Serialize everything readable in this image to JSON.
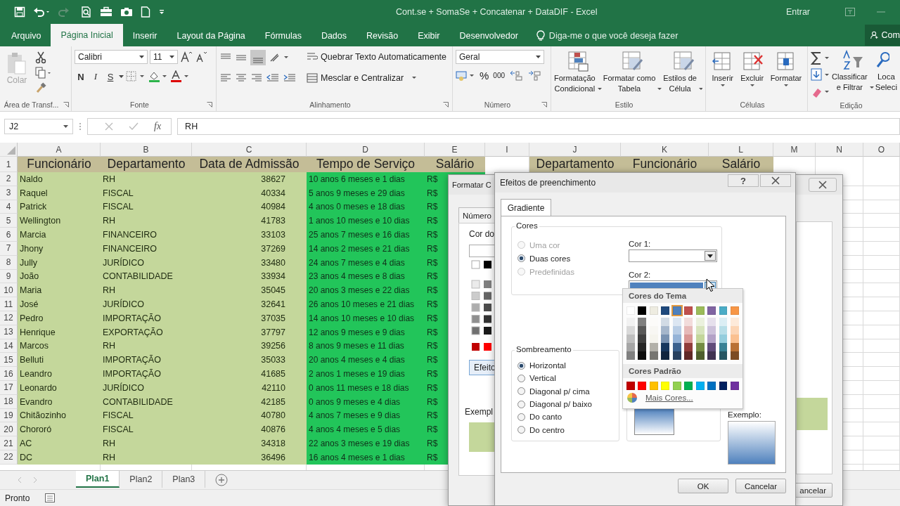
{
  "title_bar": {
    "title": "Cont.se + SomaSe + Concatenar + DataDIF - Excel",
    "sign_in": "Entrar"
  },
  "ribbon_tabs": [
    {
      "label": "Arquivo",
      "selected": false
    },
    {
      "label": "Página Inicial",
      "selected": true
    },
    {
      "label": "Inserir",
      "selected": false
    },
    {
      "label": "Layout da Página",
      "selected": false
    },
    {
      "label": "Fórmulas",
      "selected": false
    },
    {
      "label": "Dados",
      "selected": false
    },
    {
      "label": "Revisão",
      "selected": false
    },
    {
      "label": "Exibir",
      "selected": false
    },
    {
      "label": "Desenvolvedor",
      "selected": false
    }
  ],
  "tell_me": "Diga-me o que você deseja fazer",
  "share": "Com",
  "ribbon": {
    "clipboard": {
      "paste": "Colar",
      "paste_disabled": true,
      "label": "Área de Transf..."
    },
    "font": {
      "name": "Calibri",
      "size": "11",
      "bold": "N",
      "italic": "I",
      "underline": "S",
      "label": "Fonte"
    },
    "alignment": {
      "wrap": "Quebrar Texto Automaticamente",
      "merge": "Mesclar e Centralizar",
      "label": "Alinhamento"
    },
    "number": {
      "format": "Geral",
      "percent": "%",
      "thousands": "000",
      "label": "Número"
    },
    "styles": {
      "buttons": [
        [
          "Formatação",
          "Condicional"
        ],
        [
          "Formatar como",
          "Tabela"
        ],
        [
          "Estilos de",
          "Célula"
        ]
      ],
      "label": "Estilo"
    },
    "cells": {
      "buttons": [
        "Inserir",
        "Excluir",
        "Formatar"
      ],
      "label": "Células"
    },
    "editing": {
      "sort": [
        "Classificar",
        "e Filtrar"
      ],
      "find": [
        "Loca",
        "Seleci"
      ],
      "label": "Edição"
    }
  },
  "formula_bar": {
    "name_box": "J2",
    "fx": "fx",
    "formula": "RH"
  },
  "sheet": {
    "columns": [
      {
        "letter": "A",
        "kind": "text"
      },
      {
        "letter": "B",
        "kind": "text"
      },
      {
        "letter": "C",
        "kind": "number"
      },
      {
        "letter": "D",
        "kind": "duration"
      },
      {
        "letter": "E",
        "kind": "currency"
      },
      {
        "letter": "I",
        "kind": "blank"
      },
      {
        "letter": "J",
        "kind": "lookup"
      },
      {
        "letter": "K",
        "kind": "lookup"
      },
      {
        "letter": "L",
        "kind": "lookup"
      },
      {
        "letter": "M",
        "kind": "blank"
      },
      {
        "letter": "N",
        "kind": "blank"
      },
      {
        "letter": "O",
        "kind": "blank"
      }
    ],
    "header_row": {
      "number": "1",
      "cells": [
        "Funcionário",
        "Departamento",
        "Data de Admissão",
        "Tempo de Serviço",
        "Salário"
      ],
      "lookup_cells": [
        "Departamento",
        "Funcionário",
        "Salário"
      ]
    },
    "rows": [
      {
        "number": "2",
        "cells": [
          "Naldo",
          "RH",
          "38627",
          "10 anos 6 meses e 1 dias",
          "R$"
        ]
      },
      {
        "number": "3",
        "cells": [
          "Raquel",
          "FISCAL",
          "40334",
          "5 anos 9 meses e 29 dias",
          "R$"
        ]
      },
      {
        "number": "4",
        "cells": [
          "Patrick",
          "FISCAL",
          "40984",
          "4 anos 0 meses e 18 dias",
          "R$"
        ]
      },
      {
        "number": "5",
        "cells": [
          "Wellington",
          "RH",
          "41783",
          "1 anos 10 meses e 10 dias",
          "R$"
        ]
      },
      {
        "number": "6",
        "cells": [
          "Marcia",
          "FINANCEIRO",
          "33103",
          "25 anos 7 meses e 16 dias",
          "R$"
        ]
      },
      {
        "number": "7",
        "cells": [
          "Jhony",
          "FINANCEIRO",
          "37269",
          "14 anos 2 meses e 21 dias",
          "R$"
        ]
      },
      {
        "number": "8",
        "cells": [
          "Jully",
          "JURÍDICO",
          "33480",
          "24 anos 7 meses e 4 dias",
          "R$"
        ]
      },
      {
        "number": "9",
        "cells": [
          "João",
          "CONTABILIDADE",
          "33934",
          "23 anos 4 meses e 8 dias",
          "R$"
        ]
      },
      {
        "number": "10",
        "cells": [
          "Maria",
          "RH",
          "35045",
          "20 anos 3 meses e 22 dias",
          "R$"
        ]
      },
      {
        "number": "11",
        "cells": [
          "José",
          "JURÍDICO",
          "32641",
          "26 anos 10 meses e 21 dias",
          "R$"
        ]
      },
      {
        "number": "12",
        "cells": [
          "Pedro",
          "IMPORTAÇÃO",
          "37035",
          "14 anos 10 meses e 10 dias",
          "R$"
        ]
      },
      {
        "number": "13",
        "cells": [
          "Henrique",
          "EXPORTAÇÃO",
          "37797",
          "12 anos 9 meses e 9 dias",
          "R$"
        ]
      },
      {
        "number": "14",
        "cells": [
          "Marcos",
          "RH",
          "39256",
          "8 anos 9 meses e 11 dias",
          "R$"
        ]
      },
      {
        "number": "15",
        "cells": [
          "Belluti",
          "IMPORTAÇÃO",
          "35033",
          "20 anos 4 meses e 4 dias",
          "R$"
        ]
      },
      {
        "number": "16",
        "cells": [
          "Leandro",
          "IMPORTAÇÃO",
          "41685",
          "2 anos 1 meses e 19 dias",
          "R$"
        ]
      },
      {
        "number": "17",
        "cells": [
          "Leonardo",
          "JURÍDICO",
          "42110",
          "0 anos 11 meses e 18 dias",
          "R$"
        ]
      },
      {
        "number": "18",
        "cells": [
          "Evandro",
          "CONTABILIDADE",
          "42185",
          "0 anos 9 meses e 4 dias",
          "R$"
        ]
      },
      {
        "number": "19",
        "cells": [
          "Chitãozinho",
          "FISCAL",
          "40780",
          "4 anos 7 meses e 9 dias",
          "R$"
        ]
      },
      {
        "number": "20",
        "cells": [
          "Chororó",
          "FISCAL",
          "40876",
          "4 anos 4 meses e 5 dias",
          "R$"
        ]
      },
      {
        "number": "21",
        "cells": [
          "AC",
          "RH",
          "34318",
          "22 anos 3 meses e 19 dias",
          "R$"
        ]
      },
      {
        "number": "22",
        "cells": [
          "DC",
          "RH",
          "36496",
          "16 anos 4 meses e 1 dias",
          "R$"
        ]
      }
    ]
  },
  "sheet_tabs": [
    {
      "label": "Plan1",
      "selected": true
    },
    {
      "label": "Plan2",
      "selected": false
    },
    {
      "label": "Plan3",
      "selected": false
    }
  ],
  "status_bar": {
    "text": "Pronto"
  },
  "format_cells_dialog": {
    "title": "Formatar C",
    "tab": "Número",
    "fill_label": "Cor do",
    "effects_button": "Efeito",
    "sample_label": "Exempl",
    "cancel": "ancelar"
  },
  "fill_effects_dialog": {
    "title": "Efeitos de preenchimento",
    "help": "?",
    "tab": "Gradiente",
    "colors_group": "Cores",
    "color_options": [
      {
        "label": "Uma cor",
        "selected": false,
        "disabled": true
      },
      {
        "label": "Duas cores",
        "selected": true,
        "disabled": false
      },
      {
        "label": "Predefinidas",
        "selected": false,
        "disabled": true
      }
    ],
    "color1_label": "Cor 1:",
    "color2_label": "Cor 2:",
    "color2_expanded": true,
    "shading_group": "Sombreamento",
    "shading_options": [
      {
        "label": "Horizontal",
        "selected": true
      },
      {
        "label": "Vertical",
        "selected": false
      },
      {
        "label": "Diagonal p/ cima",
        "selected": false
      },
      {
        "label": "Diagonal p/ baixo",
        "selected": false
      },
      {
        "label": "Do canto",
        "selected": false
      },
      {
        "label": "Do centro",
        "selected": false
      }
    ],
    "sample_label": "Exemplo:",
    "ok": "OK",
    "cancel": "Cancelar"
  },
  "color_popup": {
    "theme_header": "Cores do Tema",
    "theme_colors": [
      {
        "color": "#ffffff",
        "selected": false
      },
      {
        "color": "#000000",
        "selected": false
      },
      {
        "color": "#eeece1",
        "selected": false
      },
      {
        "color": "#1f497d",
        "selected": false
      },
      {
        "color": "#4f81bd",
        "selected": true
      },
      {
        "color": "#c0504d",
        "selected": false
      },
      {
        "color": "#9bbb59",
        "selected": false
      },
      {
        "color": "#8064a2",
        "selected": false
      },
      {
        "color": "#4bacc6",
        "selected": false
      },
      {
        "color": "#f79646",
        "selected": false
      }
    ],
    "standard_header": "Cores Padrão",
    "standard_colors": [
      {
        "color": "#c00000",
        "selected": false
      },
      {
        "color": "#ff0000",
        "selected": false
      },
      {
        "color": "#ffc000",
        "selected": false
      },
      {
        "color": "#ffff00",
        "selected": false
      },
      {
        "color": "#92d050",
        "selected": false
      },
      {
        "color": "#00b050",
        "selected": false
      },
      {
        "color": "#00b0f0",
        "selected": false
      },
      {
        "color": "#0070c0",
        "selected": false
      },
      {
        "color": "#002060",
        "selected": false
      },
      {
        "color": "#7030a0",
        "selected": false
      }
    ],
    "more": "Mais Cores..."
  }
}
